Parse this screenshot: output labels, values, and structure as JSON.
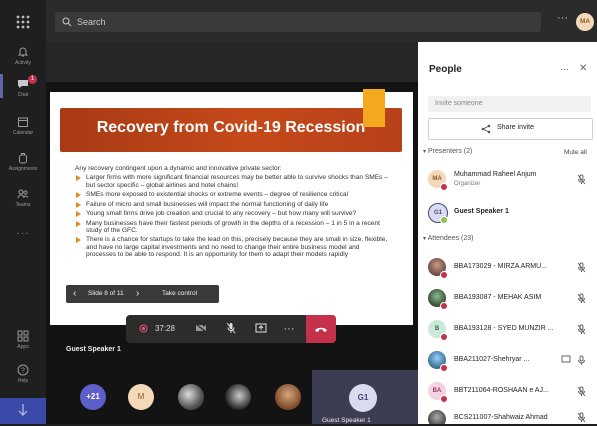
{
  "topbar": {
    "search_placeholder": "Search",
    "user_initials": "MA"
  },
  "rail": {
    "items": [
      {
        "label": "Activity"
      },
      {
        "label": "Chat",
        "badge": "1"
      },
      {
        "label": "Calendar"
      },
      {
        "label": "Assignments"
      },
      {
        "label": "Teams"
      },
      {
        "label": "Apps"
      },
      {
        "label": "Help"
      }
    ]
  },
  "slide": {
    "title": "Recovery from Covid-19 Recession",
    "lead": "Any recovery contingent upon a dynamic and innovative private sector:",
    "bullets": [
      "Larger firms with more significant financial resources may be better able to survive shocks than SMEs – but sector specific – global airlines and hotel chains!",
      "SMEs more exposed to existential shocks or extreme events – degree of resilience critical",
      "Failure of micro and small businesses will impact the normal functioning of daily life",
      "Young small firms drive job creation and crucial to any recovery – but how many will survive?",
      "Many businesses have their fastest periods of growth in the depths of a recession – 1 in 5 in a recent study of the GFC.",
      "There is a chance for startups to take the lead on this, precisely because they are small in size, flexible, and have no large capital investments and no need to change their entire business model and processes to be able to respond. It is an opportunity for them to adapt their models rapidly"
    ],
    "nav": {
      "prev": "‹",
      "counter": "Slide 8 of 11",
      "next": "›",
      "take_control": "Take control"
    }
  },
  "controls": {
    "timer": "37:28"
  },
  "speaker_label": "Guest Speaker 1",
  "strip": {
    "overflow": "+21",
    "initial_m": "M",
    "g1": "G1",
    "g1_name": "Guest Speaker 1"
  },
  "people": {
    "title": "People",
    "invite_placeholder": "Invite someone",
    "share_invite": "Share invite",
    "presenters_header": "Presenters (2)",
    "mute_all": "Mute all",
    "attendees_header": "Attendees (23)",
    "presenters": [
      {
        "initials": "MA",
        "name": "Muhammad Raheel Anjum",
        "role": "Organizer",
        "color": "#f3d9b8"
      },
      {
        "initials": "G1",
        "name": "Guest Speaker 1",
        "role": "",
        "color": "#d9dcef"
      }
    ],
    "attendees": [
      {
        "initials": "",
        "name": "BBA173029 - MIRZA ARMU...",
        "color": "#6b4a45"
      },
      {
        "initials": "",
        "name": "BBA193087 - MEHAK ASIM",
        "color": "#5a6b4d"
      },
      {
        "initials": "B",
        "name": "BBA193128 - SYED MUNZIR ...",
        "color": "#cde8d9"
      },
      {
        "initials": "",
        "name": "BBA211027-Shehryar ...",
        "color": "#3a6f8f"
      },
      {
        "initials": "BA",
        "name": "BBT211064-ROSHAAN e AJ...",
        "color": "#f3d3e0"
      },
      {
        "initials": "",
        "name": "BCS211007-Shahwaiz Ahmad",
        "color": "#6b6b6b"
      }
    ]
  },
  "colors": {
    "accent_orange": "#c54a1a",
    "teams_purple": "#464775",
    "hangup_red": "#c4314b",
    "away_red": "#c4314b"
  }
}
